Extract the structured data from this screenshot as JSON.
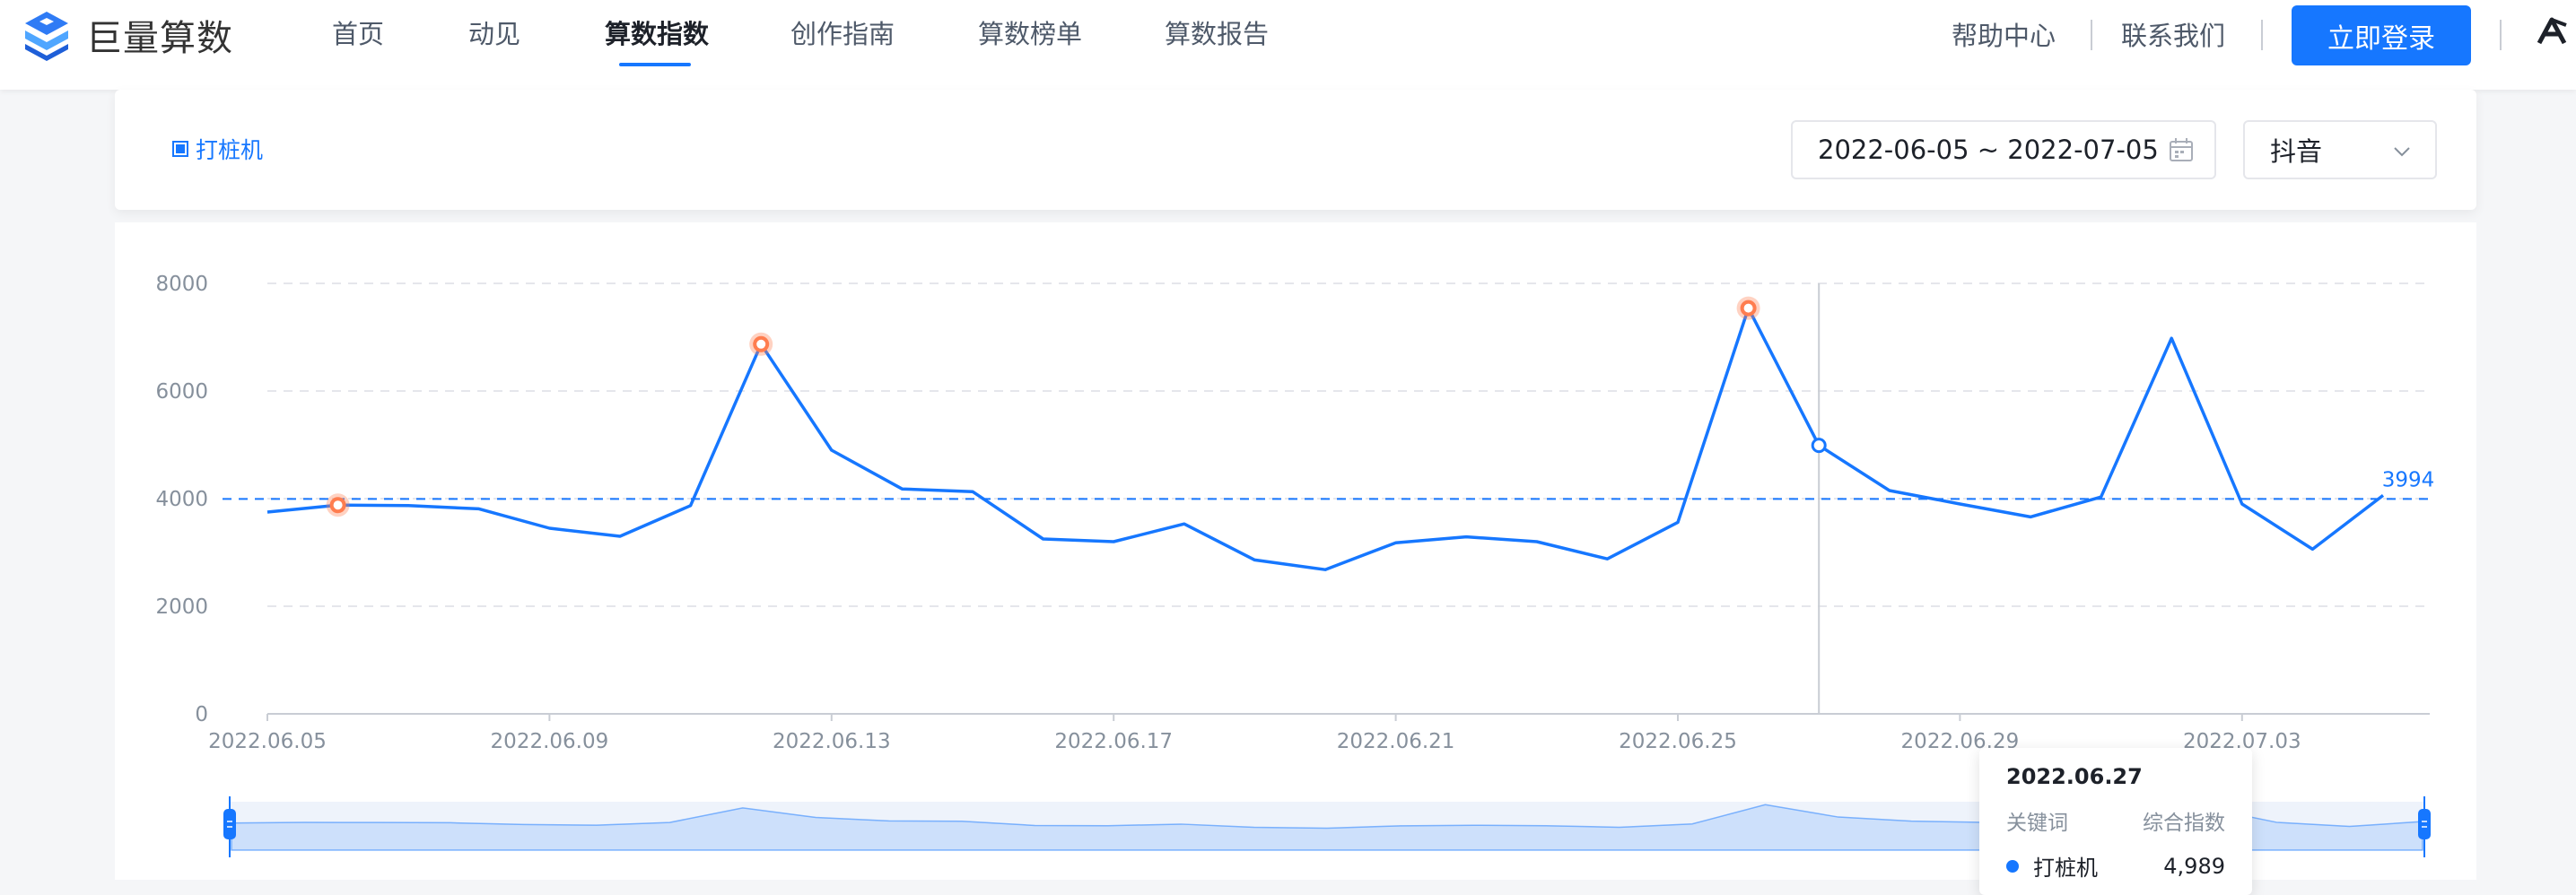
{
  "brand": {
    "name": "巨量算数"
  },
  "nav": {
    "items": [
      {
        "label": "首页"
      },
      {
        "label": "动见"
      },
      {
        "label": "算数指数"
      },
      {
        "label": "创作指南"
      },
      {
        "label": "算数榜单"
      },
      {
        "label": "算数报告"
      }
    ],
    "active_index": 2
  },
  "header_right": {
    "help": "帮助中心",
    "contact": "联系我们",
    "login": "立即登录"
  },
  "filters": {
    "keyword": "打桩机",
    "date_range": "2022-06-05 ~ 2022-07-05",
    "platform": "抖音"
  },
  "colors": {
    "accent": "#1677ff",
    "peak_marker": "#ff7d4f",
    "grid": "#e5e6eb"
  },
  "chart_data": {
    "type": "line",
    "x": [
      "2022.06.05",
      "2022.06.06",
      "2022.06.07",
      "2022.06.08",
      "2022.06.09",
      "2022.06.10",
      "2022.06.11",
      "2022.06.12",
      "2022.06.13",
      "2022.06.14",
      "2022.06.15",
      "2022.06.16",
      "2022.06.17",
      "2022.06.18",
      "2022.06.19",
      "2022.06.20",
      "2022.06.21",
      "2022.06.22",
      "2022.06.23",
      "2022.06.24",
      "2022.06.25",
      "2022.06.26",
      "2022.06.27",
      "2022.06.28",
      "2022.06.29",
      "2022.06.30",
      "2022.07.01",
      "2022.07.02",
      "2022.07.03",
      "2022.07.04",
      "2022.07.05"
    ],
    "series": [
      {
        "name": "打桩机",
        "values": [
          3750,
          3880,
          3870,
          3810,
          3450,
          3300,
          3870,
          6870,
          4900,
          4180,
          4130,
          3250,
          3200,
          3530,
          2860,
          2680,
          3180,
          3290,
          3200,
          2880,
          3560,
          7540,
          4989,
          4150,
          3900,
          3660,
          4030,
          6980,
          3900,
          3060,
          4060
        ]
      }
    ],
    "x_tick_labels": [
      "2022.06.05",
      "2022.06.09",
      "2022.06.13",
      "2022.06.17",
      "2022.06.21",
      "2022.06.25",
      "2022.06.29",
      "2022.07.03"
    ],
    "y_ticks": [
      0,
      2000,
      4000,
      6000,
      8000
    ],
    "ylim": [
      0,
      8000
    ],
    "average_line": {
      "value": 3994,
      "label": "3994"
    },
    "peak_markers": [
      "2022.06.06",
      "2022.06.12",
      "2022.06.26"
    ],
    "hover": {
      "date": "2022.06.27",
      "col_keyword": "关键词",
      "col_index": "综合指数",
      "keyword": "打桩机",
      "value": "4,989"
    },
    "grid": true,
    "legend": "none"
  }
}
